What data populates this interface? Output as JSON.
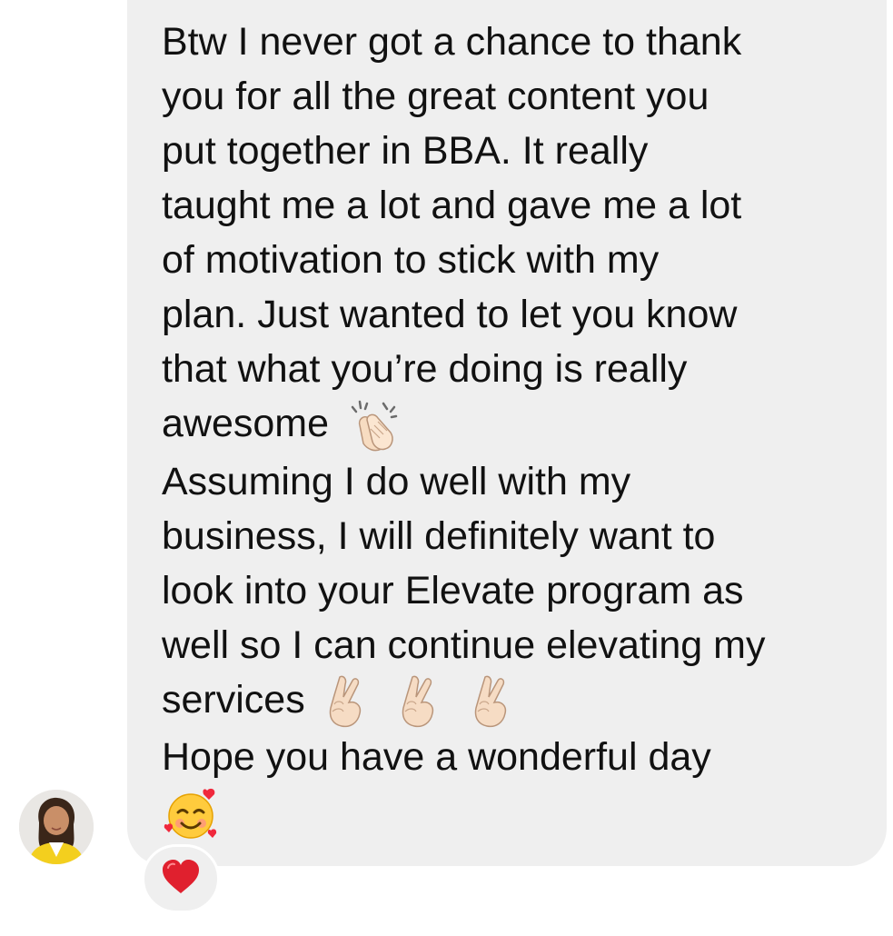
{
  "message": {
    "lines": [
      "Btw I never got a chance to thank",
      "you for all the great content you",
      "put together in BBA. It really",
      "taught me a lot and gave me a lot",
      "of motivation to stick with my",
      "plan. Just wanted to let you know",
      "that what you’re doing is really",
      "awesome",
      "Assuming I do well with my",
      "business, I will definitely want to",
      "look into your Elevate program as",
      "well so I can continue elevating my",
      "services",
      "Hope you have a wonderful day"
    ],
    "emojis": {
      "clapping": "clapping-hands-icon",
      "fingers_crossed": "crossed-fingers-icon",
      "smiling_hearts": "smiling-face-with-hearts-icon"
    }
  },
  "reaction": {
    "emoji": "red-heart-icon"
  },
  "colors": {
    "bubble": "#efefef",
    "text": "#111111",
    "heart": "#e0202e"
  }
}
